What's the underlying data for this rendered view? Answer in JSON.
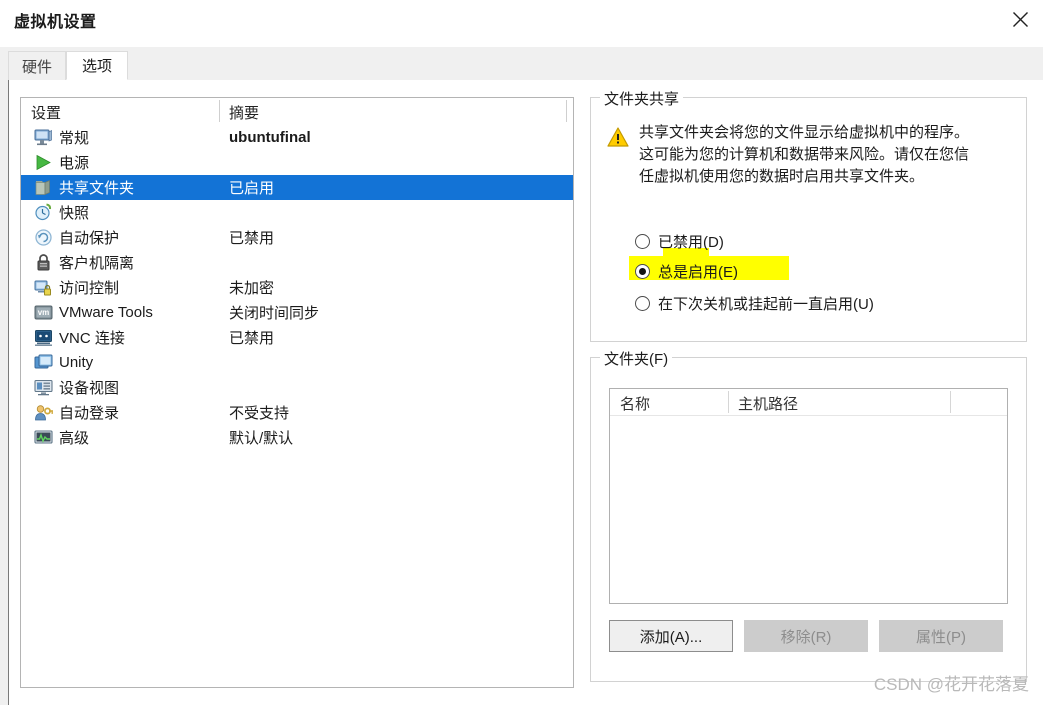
{
  "window": {
    "title": "虚拟机设置",
    "close_label": "✕"
  },
  "tabs": [
    {
      "label": "硬件",
      "active": false
    },
    {
      "label": "选项",
      "active": true
    }
  ],
  "settings_list": {
    "headers": {
      "setting": "设置",
      "summary": "摘要"
    },
    "rows": [
      {
        "icon": "monitor-icon",
        "label": "常规",
        "summary": "ubuntufinal",
        "selected": false,
        "bold": true
      },
      {
        "icon": "power-play-icon",
        "label": "电源",
        "summary": "",
        "selected": false,
        "bold": false
      },
      {
        "icon": "folder-icon",
        "label": "共享文件夹",
        "summary": "已启用",
        "selected": true,
        "bold": false
      },
      {
        "icon": "snapshot-clock-icon",
        "label": "快照",
        "summary": "",
        "selected": false,
        "bold": false
      },
      {
        "icon": "autoprotect-icon",
        "label": "自动保护",
        "summary": "已禁用",
        "selected": false,
        "bold": false
      },
      {
        "icon": "lock-icon",
        "label": "客户机隔离",
        "summary": "",
        "selected": false,
        "bold": false
      },
      {
        "icon": "access-control-icon",
        "label": "访问控制",
        "summary": "未加密",
        "selected": false,
        "bold": false
      },
      {
        "icon": "vmware-tools-icon",
        "label": "VMware Tools",
        "summary": "关闭时间同步",
        "selected": false,
        "bold": false
      },
      {
        "icon": "vnc-icon",
        "label": "VNC 连接",
        "summary": "已禁用",
        "selected": false,
        "bold": false
      },
      {
        "icon": "unity-icon",
        "label": "Unity",
        "summary": "",
        "selected": false,
        "bold": false
      },
      {
        "icon": "device-view-icon",
        "label": "设备视图",
        "summary": "",
        "selected": false,
        "bold": false
      },
      {
        "icon": "auto-login-icon",
        "label": "自动登录",
        "summary": "不受支持",
        "selected": false,
        "bold": false
      },
      {
        "icon": "advanced-icon",
        "label": "高级",
        "summary": "默认/默认",
        "selected": false,
        "bold": false
      }
    ]
  },
  "folder_sharing": {
    "group_title": "文件夹共享",
    "warning_text": "共享文件夹会将您的文件显示给虚拟机中的程序。这可能为您的计算机和数据带来风险。请仅在您信任虚拟机使用您的数据时启用共享文件夹。",
    "options": [
      {
        "label": "已禁用(D)",
        "checked": false,
        "highlighted": false
      },
      {
        "label": "总是启用(E)",
        "checked": true,
        "highlighted": true
      },
      {
        "label": "在下次关机或挂起前一直启用(U)",
        "checked": false,
        "highlighted": false
      }
    ]
  },
  "folders": {
    "group_title": "文件夹(F)",
    "columns": [
      "名称",
      "主机路径",
      ""
    ],
    "rows": [],
    "buttons": [
      {
        "label": "添加(A)...",
        "enabled": true
      },
      {
        "label": "移除(R)",
        "enabled": false
      },
      {
        "label": "属性(P)",
        "enabled": false
      }
    ]
  },
  "watermark": {
    "text": "CSDN @花开花落夏"
  },
  "colors": {
    "selection_blue": "#1373d6",
    "highlight_yellow": "#ffff00",
    "warning_yellow": "#ffcc00",
    "window_bg": "#ffffff",
    "tabstrip_bg": "#f0f0f0"
  }
}
